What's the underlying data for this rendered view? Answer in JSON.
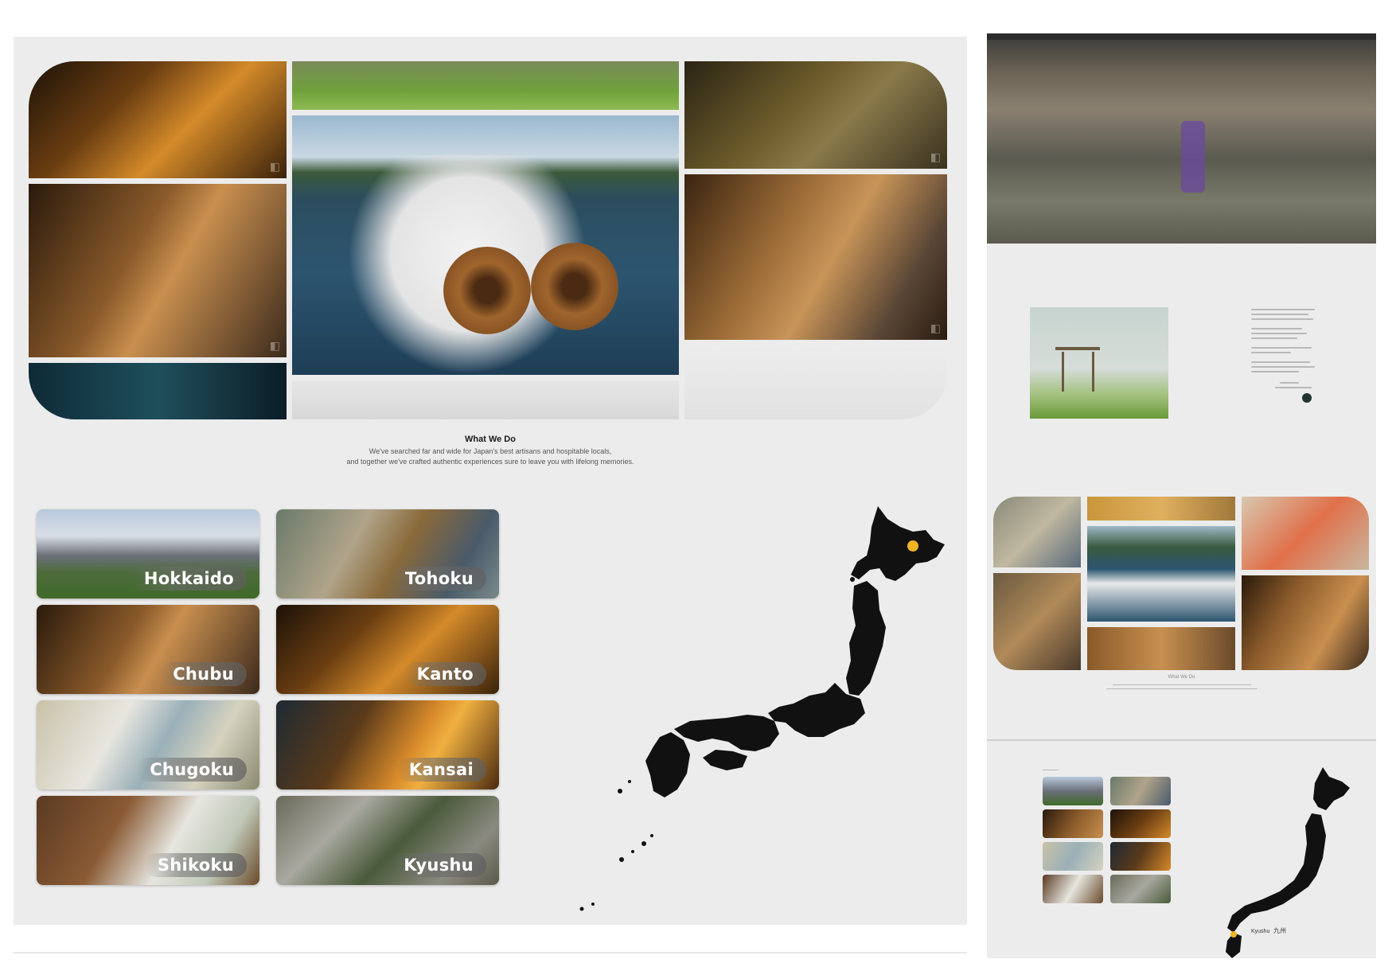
{
  "main": {
    "what_we_do": {
      "title": "What We Do",
      "line1": "We've searched far and wide for Japan's best artisans and hospitable locals,",
      "line2": "and together we've crafted authentic experiences sure to leave you with lifelong memories."
    },
    "regions": [
      {
        "label": "Hokkaido",
        "icon": "mountain-photo"
      },
      {
        "label": "Tohoku",
        "icon": "market-photo"
      },
      {
        "label": "Chubu",
        "icon": "sake-pouring-photo"
      },
      {
        "label": "Kanto",
        "icon": "geisha-photo"
      },
      {
        "label": "Chugoku",
        "icon": "cooking-photo"
      },
      {
        "label": "Kansai",
        "icon": "forge-photo"
      },
      {
        "label": "Shikoku",
        "icon": "tea-photo"
      },
      {
        "label": "Kyushu",
        "icon": "garden-photo"
      }
    ],
    "map": {
      "marker_color": "#f0b322",
      "land_color": "#111111"
    }
  },
  "preview": {
    "preview_text": {
      "what_we_do_title": "What We Do"
    },
    "map_labels": {
      "region": "Kyushu",
      "kanji": "九州"
    }
  },
  "colors": {
    "background": "#ececec",
    "accent": "#f0b322"
  }
}
